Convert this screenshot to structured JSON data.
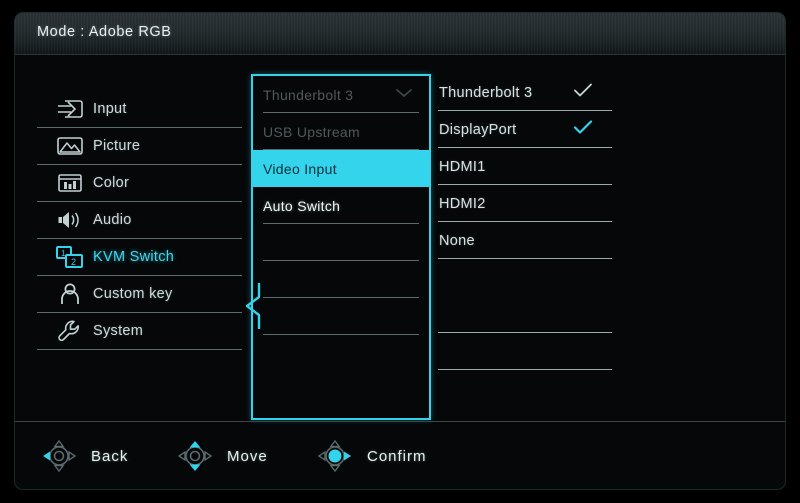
{
  "header": {
    "title": "Mode : Adobe RGB"
  },
  "colors": {
    "accent": "#33d3ec",
    "selected_bg": "#35d4ed",
    "text": "#d6e1e3",
    "dim_text": "#4e5a5c",
    "panel_bg": "#050708",
    "divider": "#5d6b6d"
  },
  "sidebar": {
    "items": [
      {
        "label": "Input",
        "icon": "input-arrow-icon",
        "active": false
      },
      {
        "label": "Picture",
        "icon": "picture-icon",
        "active": false
      },
      {
        "label": "Color",
        "icon": "color-bars-icon",
        "active": false
      },
      {
        "label": "Audio",
        "icon": "speaker-icon",
        "active": false
      },
      {
        "label": "KVM Switch",
        "icon": "kvm-switch-icon",
        "active": true
      },
      {
        "label": "Custom key",
        "icon": "person-icon",
        "active": false
      },
      {
        "label": "System",
        "icon": "wrench-icon",
        "active": false
      }
    ]
  },
  "middle_panel": {
    "rows": [
      {
        "label": "Thunderbolt 3",
        "state": "dim",
        "chevron": true
      },
      {
        "label": "USB Upstream",
        "state": "dim",
        "chevron": false
      },
      {
        "label": "Video Input",
        "state": "selected",
        "chevron": false
      },
      {
        "label": "Auto Switch",
        "state": "bright",
        "chevron": false
      },
      {
        "label": "",
        "state": "empty",
        "chevron": false
      },
      {
        "label": "",
        "state": "empty",
        "chevron": false
      },
      {
        "label": "",
        "state": "empty",
        "chevron": false
      },
      {
        "label": "",
        "state": "empty",
        "chevron": false
      }
    ]
  },
  "right_panel": {
    "rows": [
      {
        "label": "Thunderbolt 3",
        "check": "white"
      },
      {
        "label": "DisplayPort",
        "check": "accent"
      },
      {
        "label": "HDMI1",
        "check": "none"
      },
      {
        "label": "HDMI2",
        "check": "none"
      },
      {
        "label": "None",
        "check": "none"
      },
      {
        "label": "",
        "check": "none"
      },
      {
        "label": "",
        "check": "none"
      },
      {
        "label": "",
        "check": "none"
      }
    ]
  },
  "footer": {
    "hints": [
      {
        "label": "Back",
        "icon": "dpad-left-icon"
      },
      {
        "label": "Move",
        "icon": "dpad-updown-icon"
      },
      {
        "label": "Confirm",
        "icon": "dpad-center-right-icon"
      }
    ]
  }
}
